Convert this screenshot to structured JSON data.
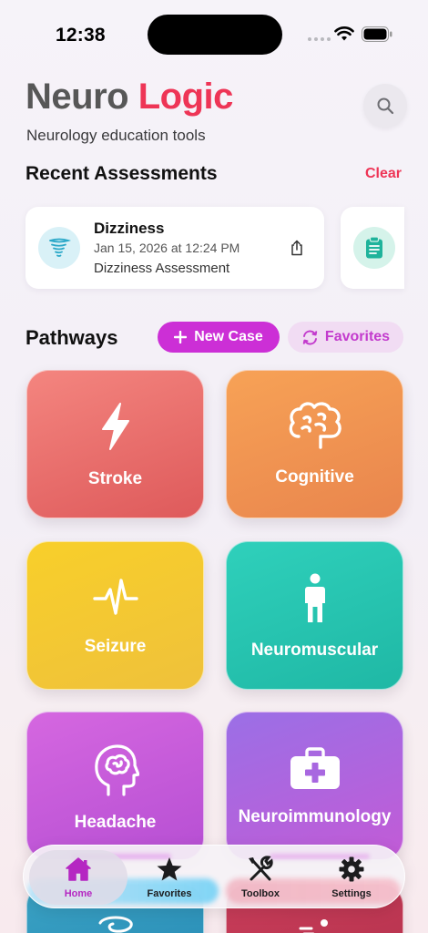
{
  "status_bar": {
    "time": "12:38"
  },
  "header": {
    "title_part1": "Neuro",
    "title_part2": "Logic",
    "subtitle": "Neurology education tools"
  },
  "recent": {
    "title": "Recent Assessments",
    "clear_label": "Clear",
    "items": [
      {
        "name": "Dizziness",
        "date": "Jan 15, 2026 at 12:24 PM",
        "description": "Dizziness Assessment",
        "icon": "tornado-icon"
      },
      {
        "icon": "clipboard-icon"
      }
    ]
  },
  "pathways": {
    "title": "Pathways",
    "new_case_label": "New Case",
    "favorites_label": "Favorites",
    "tiles": [
      {
        "label": "Stroke",
        "icon": "lightning-icon"
      },
      {
        "label": "Cognitive",
        "icon": "brain-icon"
      },
      {
        "label": "Seizure",
        "icon": "pulse-icon"
      },
      {
        "label": "Neuromuscular",
        "icon": "person-icon"
      },
      {
        "label": "Headache",
        "icon": "head-brain-icon"
      },
      {
        "label": "Neuroimmunology",
        "icon": "medical-kit-icon"
      }
    ]
  },
  "tab_bar": {
    "items": [
      {
        "label": "Home",
        "icon": "house-icon",
        "active": true
      },
      {
        "label": "Favorites",
        "icon": "star-icon"
      },
      {
        "label": "Toolbox",
        "icon": "tools-icon"
      },
      {
        "label": "Settings",
        "icon": "gear-icon"
      }
    ]
  },
  "colors": {
    "accent_red": "#ee3556",
    "accent_magenta": "#cc2fd6",
    "title_gray": "#575757"
  }
}
